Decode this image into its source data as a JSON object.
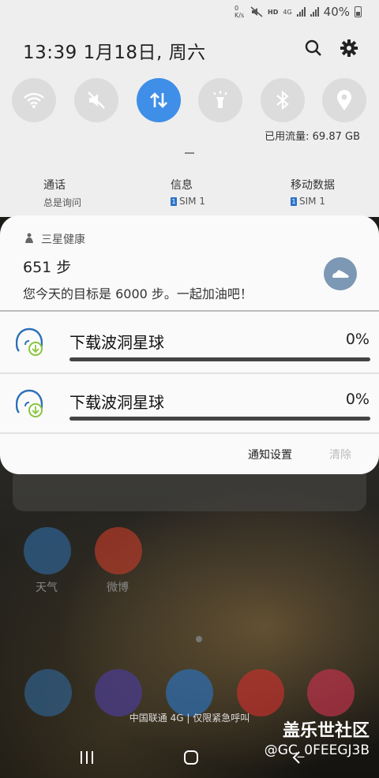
{
  "status_bar": {
    "net_speed": "0 K/s",
    "hd": "HD",
    "network": "4G",
    "battery": "40%"
  },
  "header": {
    "datetime": "13:39  1月18日, 周六",
    "icons": [
      "search-icon",
      "gear-icon"
    ]
  },
  "quick_settings": [
    {
      "name": "wifi",
      "icon": "wifi-icon",
      "active": false
    },
    {
      "name": "sound",
      "icon": "mute-icon",
      "active": false
    },
    {
      "name": "mobile-data",
      "icon": "data-arrows-icon",
      "active": true
    },
    {
      "name": "flashlight",
      "icon": "flashlight-icon",
      "active": false
    },
    {
      "name": "bluetooth",
      "icon": "bluetooth-icon",
      "active": false
    },
    {
      "name": "location",
      "icon": "location-icon",
      "active": false
    }
  ],
  "data_usage": "已用流量: 69.87 GB",
  "sim_settings": [
    {
      "title": "通话",
      "value": "总是询问"
    },
    {
      "title": "信息",
      "sim": "1",
      "value": "SIM 1"
    },
    {
      "title": "移动数据",
      "sim": "1",
      "value": "SIM 1"
    }
  ],
  "health_notification": {
    "app": "三星健康",
    "steps": "651 步",
    "message": "您今天的目标是 6000 步。一起加油吧！"
  },
  "downloads": [
    {
      "title": "下载波洞星球",
      "percent_label": "0%",
      "progress": 0
    },
    {
      "title": "下载波洞星球",
      "percent_label": "0%",
      "progress": 0
    }
  ],
  "actions": {
    "settings": "通知设置",
    "clear": "清除"
  },
  "home_apps": [
    {
      "label": "天气",
      "color": "#3d6fa6"
    },
    {
      "label": "微博",
      "color": "#c9432f"
    }
  ],
  "dock_colors": [
    "#2f5f8c",
    "#4b3d96",
    "#2c6fb5",
    "#c9302c",
    "#c8324d"
  ],
  "carrier_text": "中国联通 4G | 仅限紧急呼叫",
  "watermark": {
    "line1": "盖乐世社区",
    "line2": "@GC_0FEEGJ3B"
  },
  "colors": {
    "accent": "#3f8ee8",
    "panel_bg": "#eeeeee",
    "card_bg": "#fafafa"
  }
}
